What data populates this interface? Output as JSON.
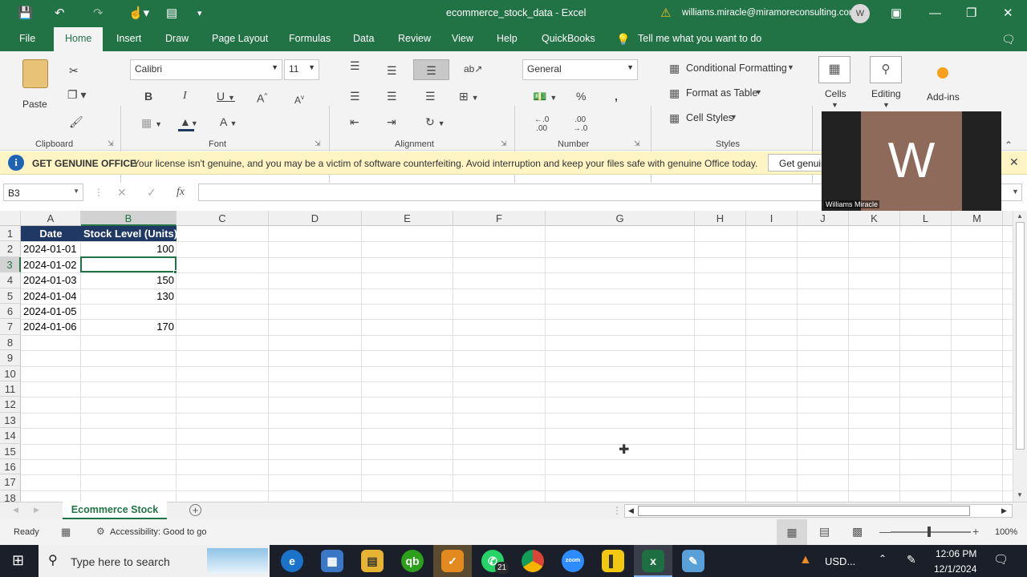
{
  "window": {
    "title": "ecommerce_stock_data  -  Excel",
    "user_email": "williams.miracle@miramoreconsulting.com",
    "avatar_letter": "W"
  },
  "tabs": [
    "File",
    "Home",
    "Insert",
    "Draw",
    "Page Layout",
    "Formulas",
    "Data",
    "Review",
    "View",
    "Help",
    "QuickBooks"
  ],
  "tell_me": "Tell me what you want to do",
  "ribbon": {
    "clipboard_label": "Clipboard",
    "paste_label": "Paste",
    "font_label": "Font",
    "font_name": "Calibri",
    "font_size": "11",
    "alignment_label": "Alignment",
    "number_label": "Number",
    "number_format": "General",
    "styles_label": "Styles",
    "conditional_formatting": "Conditional Formatting",
    "format_as_table": "Format as Table",
    "cell_styles": "Cell Styles",
    "cells_label": "Cells",
    "editing_label": "Editing",
    "addins_label": "Add-ins"
  },
  "message_bar": {
    "title": "GET GENUINE OFFICE",
    "text": "Your license isn't genuine, and you may be a victim of software counterfeiting. Avoid interruption and keep your files safe with genuine Office today.",
    "button": "Get genuine"
  },
  "formula_bar": {
    "name_box": "B3",
    "fx": "fx",
    "value": ""
  },
  "video_overlay": {
    "letter": "W",
    "name": "Williams Miracle"
  },
  "grid": {
    "columns": [
      "A",
      "B",
      "C",
      "D",
      "E",
      "F",
      "G",
      "H",
      "I",
      "J",
      "K",
      "L",
      "M"
    ],
    "rows": [
      "1",
      "2",
      "3",
      "4",
      "5",
      "6",
      "7",
      "8",
      "9",
      "10",
      "11",
      "12",
      "13",
      "14",
      "15",
      "16",
      "17",
      "18"
    ],
    "header": [
      "Date",
      "Stock Level (Units)"
    ],
    "data": [
      [
        "2024-01-01",
        "100"
      ],
      [
        "2024-01-02",
        ""
      ],
      [
        "2024-01-03",
        "150"
      ],
      [
        "2024-01-04",
        "130"
      ],
      [
        "2024-01-05",
        ""
      ],
      [
        "2024-01-06",
        "170"
      ]
    ],
    "active_cell": "B3"
  },
  "sheet_tab": "Ecommerce Stock",
  "status": {
    "ready": "Ready",
    "accessibility": "Accessibility: Good to go",
    "zoom": "100%"
  },
  "taskbar": {
    "search_placeholder": "Type here to search",
    "whatsapp_badge": "21",
    "currency": "USD...",
    "time": "12:06 PM",
    "date": "12/1/2024"
  },
  "colors": {
    "excel_green": "#217346",
    "header_fill": "#1f3864",
    "message_bar": "#fff4c4",
    "taskbar": "#1b1f2a"
  }
}
